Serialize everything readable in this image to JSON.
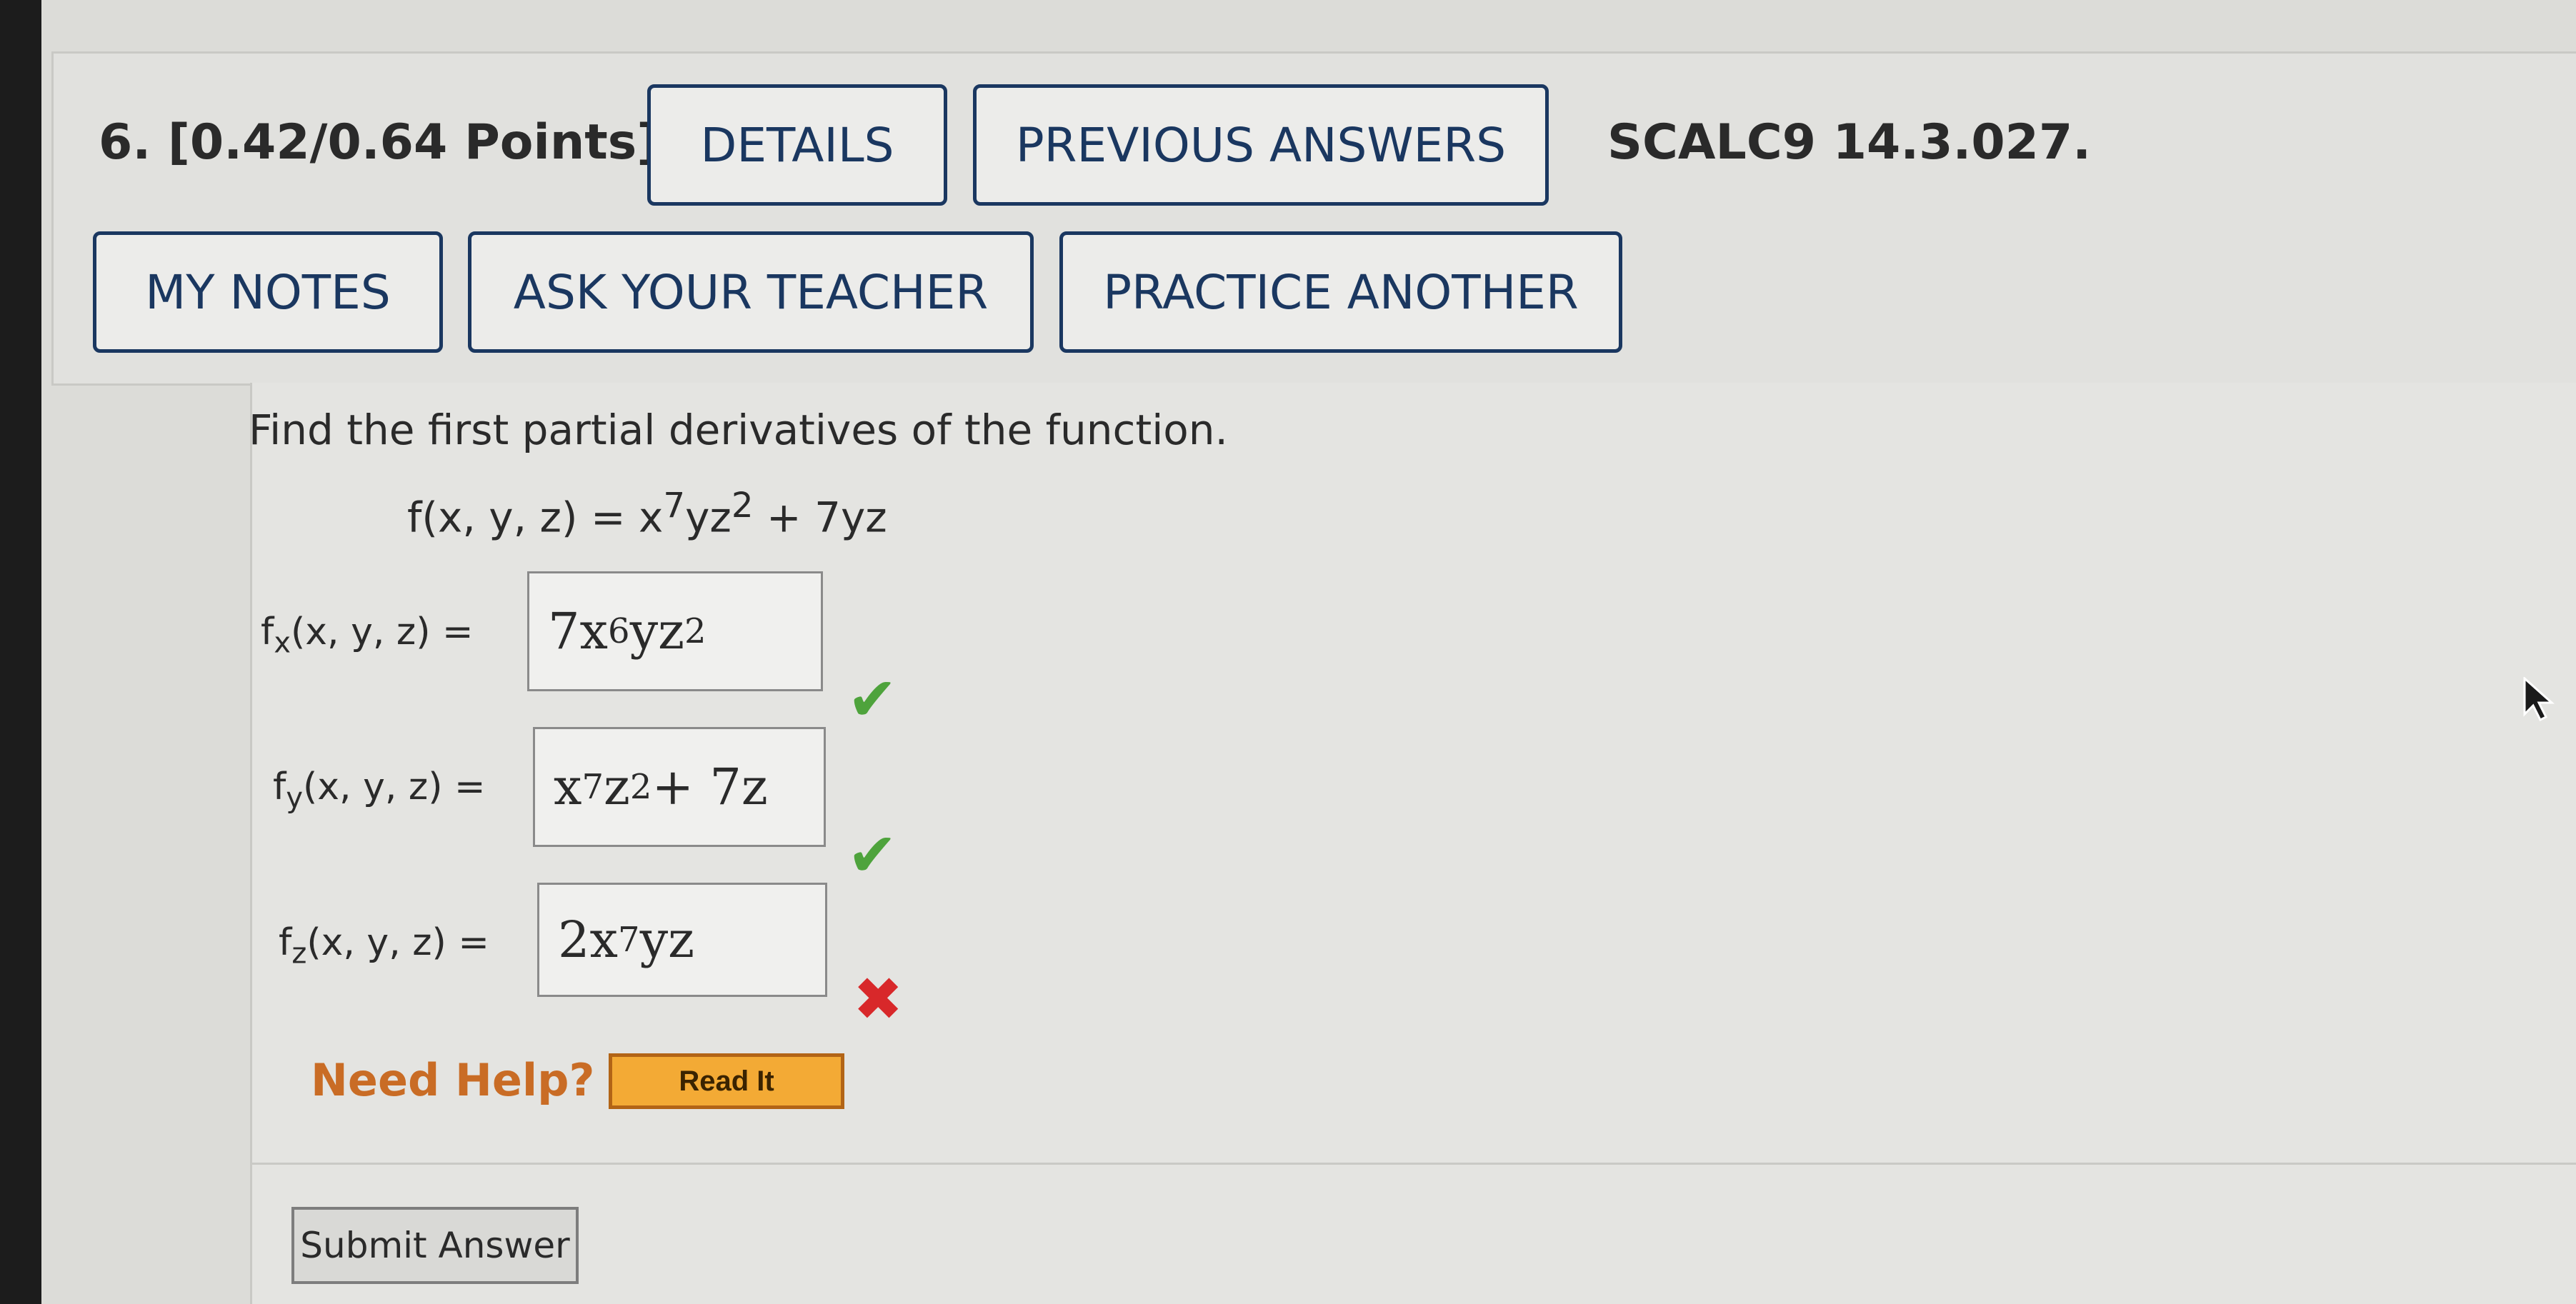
{
  "question": {
    "title": "6. [0.42/0.64 Points]",
    "source": "SCALC9 14.3.027."
  },
  "buttons": {
    "details": "DETAILS",
    "previous_answers": "PREVIOUS ANSWERS",
    "my_notes": "MY NOTES",
    "ask_teacher": "ASK YOUR TEACHER",
    "practice_another": "PRACTICE ANOTHER",
    "submit": "Submit Answer"
  },
  "problem": {
    "instruction": "Find the first partial derivatives of the function.",
    "function_lhs": "f(x, y, z) = x",
    "function_exp1": "7",
    "function_mid": "yz",
    "function_exp2": "2",
    "function_rest": " + 7yz"
  },
  "partials": {
    "fx": {
      "f": "f",
      "sub": "x",
      "args": "(x, y, z)  =",
      "a1": "7x",
      "e1": "6",
      "a2": "yz",
      "e2": "2",
      "status": "correct"
    },
    "fy": {
      "f": "f",
      "sub": "y",
      "args": "(x, y, z)  =",
      "a1": "x",
      "e1": "7",
      "a2": "z",
      "e2": "2",
      "a3": " + 7z",
      "status": "correct"
    },
    "fz": {
      "f": "f",
      "sub": "z",
      "args": "(x, y, z)  =",
      "a1": "2x",
      "e1": "7",
      "a2": "yz",
      "status": "incorrect"
    }
  },
  "marks": {
    "correct_icon": "checkmark-icon",
    "incorrect_icon": "cross-icon",
    "correct_glyph": "✔",
    "incorrect_glyph": "✖"
  },
  "help": {
    "label": "Need Help?",
    "read_it": "Read It"
  },
  "colors": {
    "button_border": "#1a3760",
    "correct": "#4ea33c",
    "incorrect": "#d8282a",
    "help_text": "#c96c25",
    "read_it_bg": "#f3aa35"
  }
}
